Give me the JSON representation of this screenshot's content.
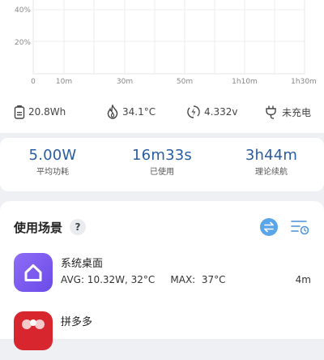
{
  "chart_data": {
    "type": "line",
    "y_ticks": [
      "40%",
      "20%"
    ],
    "x_ticks": [
      "0",
      "10m",
      "30m",
      "50m",
      "1h10m",
      "1h30m"
    ],
    "series": []
  },
  "battery_info": {
    "capacity": "20.8Wh",
    "temperature": "34.1°C",
    "voltage": "4.332v",
    "charging_status": "未充电"
  },
  "stats": {
    "avg_power": {
      "value": "5.00W",
      "label": "平均功耗"
    },
    "used": {
      "value": "16m33s",
      "label": "已使用"
    },
    "remaining": {
      "value": "3h44m",
      "label": "理论续航"
    }
  },
  "scenes": {
    "title": "使用场景",
    "help": "?",
    "apps": [
      {
        "name": "系统桌面",
        "stats": "AVG: 10.32W, 32°C     MAX:  37°C",
        "time": "4m",
        "icon": "home-icon",
        "color": "#7b5cf0"
      },
      {
        "name": "拼多多",
        "stats": "",
        "time": "",
        "icon": "pinduoduo-icon",
        "color": "#d8262e"
      }
    ]
  }
}
